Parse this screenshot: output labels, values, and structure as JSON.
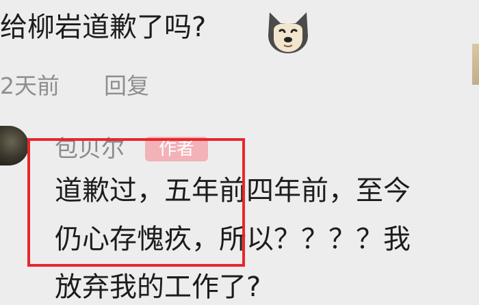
{
  "parent_comment": {
    "text": "给柳岩道歉了吗?",
    "emoji_icon": "doge-icon",
    "time": "2天前",
    "reply_label": "回复"
  },
  "reply": {
    "username": "包贝尔",
    "badge": "作者",
    "lines": [
      "道歉过，五年前四年前，至今",
      "仍心存愧疚，所以？？？？我",
      "放弃我的工作了?"
    ]
  },
  "colors": {
    "background": "#ededed",
    "highlight_border": "#e8262d",
    "author_badge": "#f2b2b8"
  }
}
